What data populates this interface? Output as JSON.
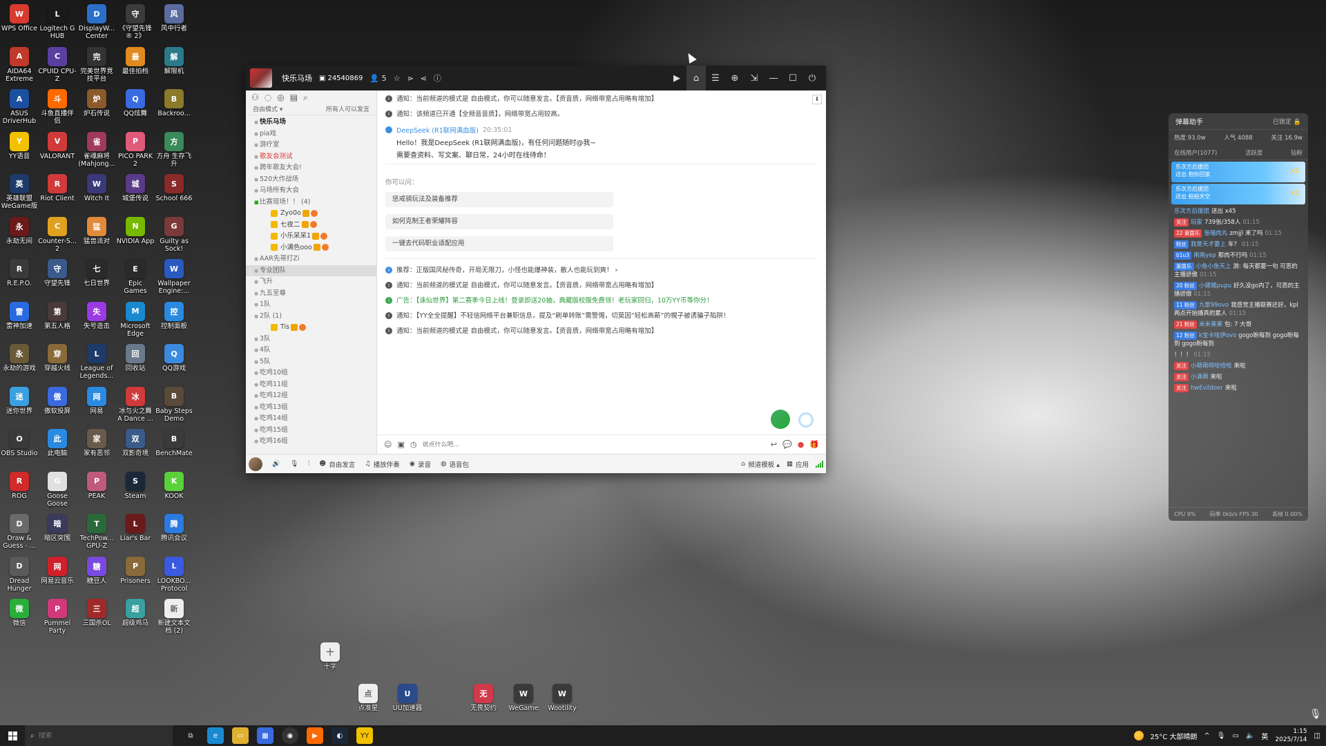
{
  "desktop": {
    "icons": [
      {
        "label": "WPS Office",
        "icon": "wps-icon",
        "color": "#d83b2f"
      },
      {
        "label": "Logitech G HUB",
        "icon": "logitech-icon",
        "color": "#1a1a1a"
      },
      {
        "label": "DisplayW... Center",
        "icon": "display-icon",
        "color": "#2b6fc9"
      },
      {
        "label": "《守望先锋® 2》",
        "icon": "overwatch-icon",
        "color": "#3b3b3b"
      },
      {
        "label": "风中行者",
        "icon": "wind-icon",
        "color": "#5a6ca0"
      },
      {
        "label": "AIDA64 Extreme",
        "icon": "aida-icon",
        "color": "#c0392b"
      },
      {
        "label": "CPUID CPU-Z",
        "icon": "cpuz-icon",
        "color": "#5b3fa0"
      },
      {
        "label": "完美世界竞技平台",
        "icon": "perfect-icon",
        "color": "#333333"
      },
      {
        "label": "最佳拍档",
        "icon": "partner-icon",
        "color": "#e08a20"
      },
      {
        "label": "解限机",
        "icon": "mecha-icon",
        "color": "#2a7a8a"
      },
      {
        "label": "ASUS DriverHub",
        "icon": "asus-icon",
        "color": "#1b4fa0"
      },
      {
        "label": "斗鱼直播伴侣",
        "icon": "douyu-icon",
        "color": "#ff6a00"
      },
      {
        "label": "炉石传说",
        "icon": "hearthstone-icon",
        "color": "#8a5a2a"
      },
      {
        "label": "QQ炫舞",
        "icon": "qqdance-icon",
        "color": "#3a6ae0"
      },
      {
        "label": "Backroo...",
        "icon": "backrooms-icon",
        "color": "#8a7a2a"
      },
      {
        "label": "YY语音",
        "icon": "yy-icon",
        "color": "#f2c200"
      },
      {
        "label": "VALORANT",
        "icon": "valorant-icon",
        "color": "#d13a3a"
      },
      {
        "label": "雀魂麻将(Mahjong...",
        "icon": "mahjong-icon",
        "color": "#a03a5a"
      },
      {
        "label": "PICO PARK 2",
        "icon": "picopark-icon",
        "color": "#e05a7a"
      },
      {
        "label": "方舟 生存飞升",
        "icon": "ark-icon",
        "color": "#3a8a5a"
      },
      {
        "label": "英雄联盟WeGame版",
        "icon": "lol-wegame-icon",
        "color": "#1e3a6a"
      },
      {
        "label": "Riot Client",
        "icon": "riot-icon",
        "color": "#d13a3a"
      },
      {
        "label": "Witch It",
        "icon": "witchit-icon",
        "color": "#3a3a7a"
      },
      {
        "label": "城堡传说",
        "icon": "castle-icon",
        "color": "#5a3a8a"
      },
      {
        "label": "School 666",
        "icon": "school-icon",
        "color": "#8a2a2a"
      },
      {
        "label": "永劫无间",
        "icon": "naraka-icon",
        "color": "#6a1a1a"
      },
      {
        "label": "Counter-S... 2",
        "icon": "cs2-icon",
        "color": "#e0a020"
      },
      {
        "label": "猛兽派对",
        "icon": "party-animals-icon",
        "color": "#e08a3a"
      },
      {
        "label": "NVIDIA App",
        "icon": "nvidia-icon",
        "color": "#76b900"
      },
      {
        "label": "Guilty as Sock!",
        "icon": "sock-icon",
        "color": "#7a3a3a"
      },
      {
        "label": "R.E.P.O.",
        "icon": "repo-icon",
        "color": "#3a3a3a"
      },
      {
        "label": "守望先锋",
        "icon": "overwatch2-icon",
        "color": "#3a5a8a"
      },
      {
        "label": "七日世界",
        "icon": "once-human-icon",
        "color": "#2a2a2a"
      },
      {
        "label": "Epic Games Launcher",
        "icon": "epic-icon",
        "color": "#2a2a2a"
      },
      {
        "label": "Wallpaper Engine:...",
        "icon": "wallpaper-engine-icon",
        "color": "#2a5ac0"
      },
      {
        "label": "雷神加速",
        "icon": "leishen-icon",
        "color": "#2a6ae0"
      },
      {
        "label": "第五人格",
        "icon": "identityv-icon",
        "color": "#4a3a3a"
      },
      {
        "label": "失号造击",
        "icon": "game-icon",
        "color": "#9a3ae0"
      },
      {
        "label": "Microsoft Edge",
        "icon": "edge-icon",
        "color": "#1a8ad0"
      },
      {
        "label": "控制面板",
        "icon": "control-panel-icon",
        "color": "#2a8ae0"
      },
      {
        "label": "永劫的游戏",
        "icon": "game2-icon",
        "color": "#6a5a3a"
      },
      {
        "label": "穿越火线",
        "icon": "crossfire-icon",
        "color": "#8a6a3a"
      },
      {
        "label": "League of Legends...",
        "icon": "lol-icon",
        "color": "#1e3a6a"
      },
      {
        "label": "回收站",
        "icon": "recycle-bin-icon",
        "color": "#6a7a8a"
      },
      {
        "label": "QQ游戏",
        "icon": "qqgame-icon",
        "color": "#3a8ae0"
      },
      {
        "label": "迷你世界",
        "icon": "miniworld-icon",
        "color": "#3aa0e0"
      },
      {
        "label": "傲软投屏",
        "icon": "apowermirror-icon",
        "color": "#3a6ae0"
      },
      {
        "label": "网易",
        "icon": "netease-icon",
        "color": "#2a8ae0"
      },
      {
        "label": "冰与火之舞 A Dance ...",
        "icon": "adofai-icon",
        "color": "#d03a3a"
      },
      {
        "label": "Baby Steps Demo",
        "icon": "babysteps-icon",
        "color": "#5a4a3a"
      },
      {
        "label": "OBS Studio",
        "icon": "obs-icon",
        "color": "#3a3a3a"
      },
      {
        "label": "此电脑",
        "icon": "this-pc-icon",
        "color": "#2a8ae0"
      },
      {
        "label": "家有恶邻",
        "icon": "neighbor-icon",
        "color": "#6a5a4a"
      },
      {
        "label": "双影奇境",
        "icon": "splitfiction-icon",
        "color": "#3a5a8a"
      },
      {
        "label": "BenchMate",
        "icon": "benchmate-icon",
        "color": "#3a3a3a"
      },
      {
        "label": "ROG",
        "icon": "rog-icon",
        "color": "#d02a2a"
      },
      {
        "label": "Goose Goose Duck",
        "icon": "goose-icon",
        "color": "#e0e0e0"
      },
      {
        "label": "PEAK",
        "icon": "peak-icon",
        "color": "#c05a7a"
      },
      {
        "label": "Steam",
        "icon": "steam-icon",
        "color": "#1b2838"
      },
      {
        "label": "KOOK",
        "icon": "kook-icon",
        "color": "#5ad03a"
      },
      {
        "label": "Draw & Guess - ...",
        "icon": "drawguess-icon",
        "color": "#6a6a6a"
      },
      {
        "label": "暗区突围",
        "icon": "arena-breakout-icon",
        "color": "#3a3a5a"
      },
      {
        "label": "TechPow... GPU-Z",
        "icon": "gpuz-icon",
        "color": "#2a6a3a"
      },
      {
        "label": "Liar's Bar",
        "icon": "liarsbar-icon",
        "color": "#6a1a1a"
      },
      {
        "label": "腾讯会议",
        "icon": "tencent-meeting-icon",
        "color": "#2a7ae0"
      },
      {
        "label": "Dread Hunger",
        "icon": "dreadhunger-icon",
        "color": "#5a5a5a"
      },
      {
        "label": "网易云音乐",
        "icon": "netease-music-icon",
        "color": "#d0202a"
      },
      {
        "label": "糖豆人",
        "icon": "fallguys-icon",
        "color": "#7a4ae0"
      },
      {
        "label": "Prisoners",
        "icon": "prisoners-icon",
        "color": "#8a6a3a"
      },
      {
        "label": "LOOKBO... Protocol",
        "icon": "lookbook-icon",
        "color": "#3a5ae0"
      },
      {
        "label": "微信",
        "icon": "wechat-icon",
        "color": "#2aae3a"
      },
      {
        "label": "Pummel Party",
        "icon": "pummel-icon",
        "color": "#d03a7a"
      },
      {
        "label": "三国杀OL",
        "icon": "sanguosha-icon",
        "color": "#a02a2a"
      },
      {
        "label": "超级鸡马",
        "icon": "ultimate-chicken-icon",
        "color": "#3aa0a0"
      },
      {
        "label": "新建文本文档 (2)",
        "icon": "text-file-icon",
        "color": "#eeeeee"
      },
      {
        "label": "十字",
        "icon": "text-file-icon",
        "color": "#eeeeee"
      },
      {
        "label": "点准星",
        "icon": "text-file-icon",
        "color": "#eeeeee"
      },
      {
        "label": "UU加速器",
        "icon": "uu-icon",
        "color": "#2a4a8a"
      },
      {
        "label": "无畏契约",
        "icon": "valorant-cn-icon",
        "color": "#d03a4a"
      },
      {
        "label": "WeGame",
        "icon": "wegame-icon",
        "color": "#3a3a3a"
      },
      {
        "label": "Wootility",
        "icon": "wootility-icon",
        "color": "#3a3a3a"
      }
    ]
  },
  "yy": {
    "title": {
      "channel_name": "快乐马场",
      "channel_id": "24540869",
      "members": "5"
    },
    "left": {
      "mode": "自由模式 ▾",
      "mode_right": "所有人可以发言",
      "tree": [
        {
          "text": "快乐马场",
          "kind": "root"
        },
        {
          "text": "pia戏",
          "kind": "normal"
        },
        {
          "text": "游疗室",
          "kind": "normal"
        },
        {
          "text": "歌友会测试",
          "kind": "red"
        },
        {
          "text": "跨年歌友大会!",
          "kind": "normal"
        },
        {
          "text": "520大作战场",
          "kind": "normal"
        },
        {
          "text": "马场所有大会",
          "kind": "normal"
        },
        {
          "text": "比赛现场！！ (4)",
          "kind": "green"
        },
        {
          "text": "Zyo0o",
          "kind": "member"
        },
        {
          "text": "七夜二",
          "kind": "member"
        },
        {
          "text": "小乐呆呆1",
          "kind": "member"
        },
        {
          "text": "小满色ooo",
          "kind": "member"
        },
        {
          "text": "AAR先哥打Zi",
          "kind": "normal"
        },
        {
          "text": "专业团队",
          "kind": "sel"
        },
        {
          "text": "飞升",
          "kind": "normal"
        },
        {
          "text": "九五至尊",
          "kind": "normal"
        },
        {
          "text": "1队",
          "kind": "normal"
        },
        {
          "text": "2队 (1)",
          "kind": "normal"
        },
        {
          "text": "Tis",
          "kind": "member"
        },
        {
          "text": "3队",
          "kind": "normal"
        },
        {
          "text": "4队",
          "kind": "normal"
        },
        {
          "text": "5队",
          "kind": "normal"
        },
        {
          "text": "吃鸡10组",
          "kind": "normal"
        },
        {
          "text": "吃鸡11组",
          "kind": "normal"
        },
        {
          "text": "吃鸡12组",
          "kind": "normal"
        },
        {
          "text": "吃鸡13组",
          "kind": "normal"
        },
        {
          "text": "吃鸡14组",
          "kind": "normal"
        },
        {
          "text": "吃鸡15组",
          "kind": "normal"
        },
        {
          "text": "吃鸡16组",
          "kind": "normal"
        }
      ]
    },
    "chat": {
      "top_msgs": [
        {
          "text": "通知：当前频道的模式是 自由模式，你可以随意发言。【资音质，网络带宽占用略有增加】",
          "kind": "notice"
        },
        {
          "text": "通知：该频道已开通【全频音音质】，网络带宽占用较高。",
          "kind": "notice"
        }
      ],
      "ds_name": "DeepSeek (R1联网满血版)",
      "ds_time": "20:35:01",
      "ds_line1": "Hello！我是DeepSeek (R1联网满血版)，有任何问题随时@我~",
      "ds_line2": "需要查资料、写文案、聊日常，24小时在线待命！",
      "ask_label": "你可以问：",
      "asks": [
        "惩戒骑玩法及装备推荐",
        "如何克制王者荣耀阵容",
        "一键去代码职业适配应用"
      ],
      "bottom_msgs": [
        {
          "text": "推荐：正版国风秘传奇，开局无限刀，小怪也能爆神装，散人也能玩到爽！ ›",
          "kind": "blue"
        },
        {
          "text": "通知：当前频道的模式是 自由模式，你可以随意发言。【资音质，网络带宽占用略有增加】",
          "kind": "notice"
        },
        {
          "text": "广告：【诛仙世界】第二赛季今日上线！登录即送20抽，典藏版校服免费领！老玩家回归，10万YY币等你分！",
          "kind": "green"
        },
        {
          "text": "通知：【YY全全提醒】不轻信网络平台兼职信息，提及“刷单转账”需警惕，切莫因“轻松高薪”的幌子被诱骗子陷阱！",
          "kind": "notice"
        },
        {
          "text": "通知：当前频道的模式是 自由模式，你可以随意发言。【资音质，网络带宽占用略有增加】",
          "kind": "notice"
        }
      ],
      "input_placeholder": "说点什么吧..."
    },
    "bottombar": {
      "free_talk": "自由发言",
      "play_music": "播放伴奏",
      "record": "录音",
      "voice_pack": "语音包",
      "channel_mode": "频道模板 ▴",
      "apps": "应用"
    }
  },
  "danmaku": {
    "title": "弹幕助手",
    "lock_label": "已锁定",
    "stats": [
      "热度 93.0w",
      "人气 4088",
      "关注 16.9w"
    ],
    "tabs": [
      "在线用户(1077)",
      "活跃度",
      "钻粉"
    ],
    "gifts": [
      {
        "name": "乐次方后援团",
        "sub": "送出 抱你回家",
        "amt": "x1"
      },
      {
        "name": "乐次方后援团",
        "sub": "送出 拍拍天空",
        "amt": "x1"
      }
    ],
    "lines": [
      {
        "tag": "",
        "tagc": "",
        "user": "乐次方后援团",
        "text": "送出 x45",
        "ts": ""
      },
      {
        "tag": "关注",
        "tagc": "red",
        "user": "玩家",
        "text": "739张/358人",
        "ts": "01:15"
      },
      {
        "tag": "22 莱茵乐",
        "tagc": "red",
        "user": "张喵肉丸",
        "text": "zmjjl 来了吗",
        "ts": "01:15"
      },
      {
        "tag": "粉丝",
        "tagc": "blue",
        "user": "我是天才要上",
        "text": "车？",
        "ts": "01:15"
      },
      {
        "tag": "b1u3",
        "tagc": "blue",
        "user": "南南yep",
        "text": "那肉不行吗",
        "ts": "01:15"
      },
      {
        "tag": "莱茵乐",
        "tagc": "blue",
        "user": "小鱼小鱼天上",
        "text": "游: 每天都要一句 可恶的主播骄傲",
        "ts": "01:15"
      },
      {
        "tag": "20 粉丝",
        "tagc": "blue",
        "user": "小猪猪pupu",
        "text": "好久没go内了，可恶的主播骄傲",
        "ts": "01:15"
      },
      {
        "tag": "11 粉丝",
        "tagc": "blue",
        "user": "九歌99ovo",
        "text": "我感觉主播联赛还好，kpl两点开始播真的累人",
        "ts": "01:15"
      },
      {
        "tag": "21 粉丝",
        "tagc": "red",
        "user": "米米莱莱",
        "text": "包: 7 大哥",
        "ts": ""
      },
      {
        "tag": "12 粉丝",
        "tagc": "blue",
        "user": "k宝卡哇伊ovo",
        "text": "gogo盼每到 gogo盼每到 gogo盼每到",
        "ts": ""
      },
      {
        "tag": "",
        "tagc": "",
        "user": "",
        "text": "！！！",
        "ts": "01:15"
      },
      {
        "tag": "关注",
        "tagc": "red",
        "user": "小萌萌呀哈哈哈",
        "text": "来啦",
        "ts": ""
      },
      {
        "tag": "关注",
        "tagc": "red",
        "user": "小满萌",
        "text": "来啦",
        "ts": ""
      },
      {
        "tag": "关注",
        "tagc": "red",
        "user": "hwEvildoer",
        "text": "来啦",
        "ts": ""
      }
    ],
    "footer": [
      "CPU 9%",
      "码率 0kb/s FPS 30",
      "丢帧 0.00%"
    ]
  },
  "taskbar": {
    "search_placeholder": "搜索",
    "weather": "25°C 大部晴朗",
    "lang": "英",
    "time": "1:15",
    "date": "2025/7/14"
  }
}
